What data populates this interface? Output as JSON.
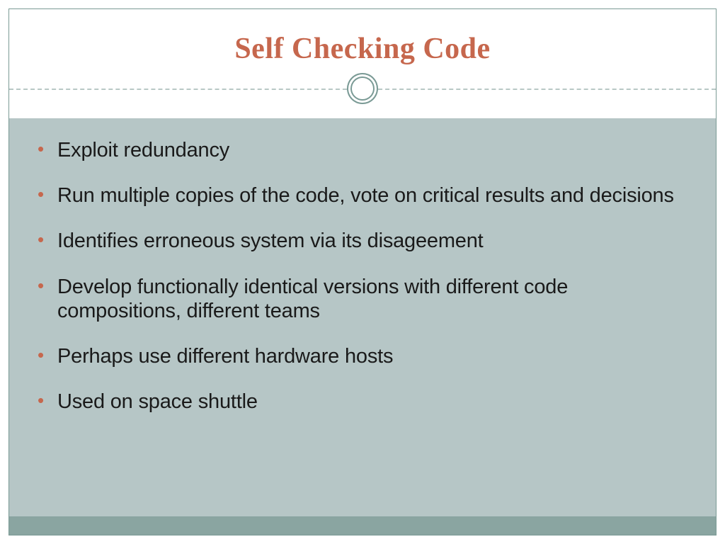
{
  "title": "Self Checking Code",
  "bullets": [
    "Exploit redundancy",
    "Run multiple copies of the code, vote on critical results and decisions",
    "Identifies erroneous system via its disageement",
    "Develop functionally identical versions with different code compositions, different teams",
    "Perhaps use different hardware hosts",
    "Used on space shuttle"
  ],
  "colors": {
    "accent": "#c6674d",
    "body_bg": "#b6c6c6",
    "footer": "#8aa5a1",
    "border": "#7a9a95"
  }
}
